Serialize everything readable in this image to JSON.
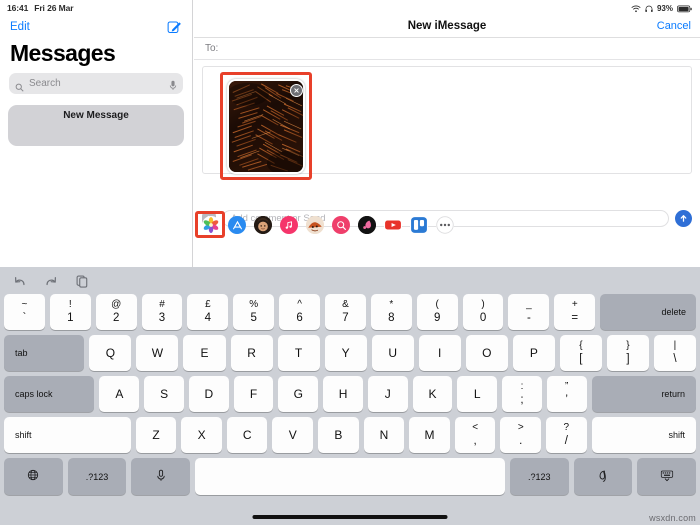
{
  "status_bar": {
    "time": "16:41",
    "date": "Fri 26 Mar",
    "battery_percent": "93%",
    "wifi_icon": "wifi-icon",
    "headphones_icon": "headphones-icon",
    "battery_icon": "battery-icon"
  },
  "sidebar": {
    "edit_label": "Edit",
    "compose_icon": "compose-icon",
    "title": "Messages",
    "search": {
      "placeholder": "Search",
      "search_icon": "search-icon",
      "mic_icon": "microphone-icon"
    },
    "conversations": [
      {
        "label": "New Message"
      }
    ]
  },
  "detail": {
    "nav_title": "New iMessage",
    "cancel_label": "Cancel",
    "to_label": "To:",
    "attachment": {
      "close_icon": "close-icon",
      "highlight_color": "#e8402a",
      "description": "photo-attachment-thumbnail"
    },
    "compose": {
      "expand_icon": "chevron-right-icon",
      "placeholder": "Add comment or Send",
      "send_icon": "send-arrow-up-icon"
    },
    "app_drawer": [
      {
        "name": "photos-app",
        "icon": "photos-icon",
        "highlighted": true
      },
      {
        "name": "app-store",
        "icon": "app-store-icon",
        "highlighted": false
      },
      {
        "name": "memoji-stickers",
        "icon": "memoji-icon",
        "highlighted": false
      },
      {
        "name": "music-app",
        "icon": "music-note-icon",
        "highlighted": false
      },
      {
        "name": "animoji-app",
        "icon": "animoji-icon",
        "highlighted": false
      },
      {
        "name": "image-search-app",
        "icon": "magnifier-icon",
        "highlighted": false
      },
      {
        "name": "digital-touch-app",
        "icon": "digital-touch-icon",
        "highlighted": false
      },
      {
        "name": "youtube-app",
        "icon": "youtube-icon",
        "highlighted": false
      },
      {
        "name": "trello-app",
        "icon": "trello-icon",
        "highlighted": false
      },
      {
        "name": "more-apps",
        "icon": "ellipsis-icon",
        "highlighted": false
      }
    ]
  },
  "keyboard": {
    "toolbar": [
      {
        "name": "undo-button",
        "icon": "undo-arrow-icon"
      },
      {
        "name": "redo-button",
        "icon": "redo-arrow-icon"
      },
      {
        "name": "paste-button",
        "icon": "paste-clipboard-icon"
      }
    ],
    "row_numbers": [
      {
        "top": "~",
        "bot": "`"
      },
      {
        "top": "!",
        "bot": "1"
      },
      {
        "top": "@",
        "bot": "2"
      },
      {
        "top": "#",
        "bot": "3"
      },
      {
        "top": "£",
        "bot": "4"
      },
      {
        "top": "%",
        "bot": "5"
      },
      {
        "top": "^",
        "bot": "6"
      },
      {
        "top": "&",
        "bot": "7"
      },
      {
        "top": "*",
        "bot": "8"
      },
      {
        "top": "(",
        "bot": "9"
      },
      {
        "top": ")",
        "bot": "0"
      },
      {
        "top": "_",
        "bot": "-"
      },
      {
        "top": "+",
        "bot": "="
      }
    ],
    "delete_label": "delete",
    "tab_label": "tab",
    "row_top": [
      "Q",
      "W",
      "E",
      "R",
      "T",
      "Y",
      "U",
      "I",
      "O",
      "P"
    ],
    "row_top_extra": [
      {
        "top": "{",
        "bot": "["
      },
      {
        "top": "}",
        "bot": "]"
      },
      {
        "top": "|",
        "bot": "\\"
      }
    ],
    "caps_label": "caps lock",
    "row_home": [
      "A",
      "S",
      "D",
      "F",
      "G",
      "H",
      "J",
      "K",
      "L"
    ],
    "row_home_extra": [
      {
        "top": ":",
        "bot": ";"
      },
      {
        "top": "”",
        "bot": "’"
      }
    ],
    "return_label": "return",
    "shift_left_label": "shift",
    "row_bottom": [
      "Z",
      "X",
      "C",
      "V",
      "B",
      "N",
      "M"
    ],
    "row_bottom_extra": [
      {
        "top": "<",
        "bot": ","
      },
      {
        "top": ">",
        "bot": "."
      },
      {
        "top": "?",
        "bot": "/"
      }
    ],
    "shift_right_label": "shift",
    "globe_icon": "globe-icon",
    "num_left_label": ".?123",
    "dictation_icon": "microphone-icon",
    "space_label": "",
    "num_right_label": ".?123",
    "handwriting_icon": "handwriting-icon",
    "dismiss_icon": "keyboard-dismiss-icon"
  },
  "watermark": "wsxdn.com"
}
